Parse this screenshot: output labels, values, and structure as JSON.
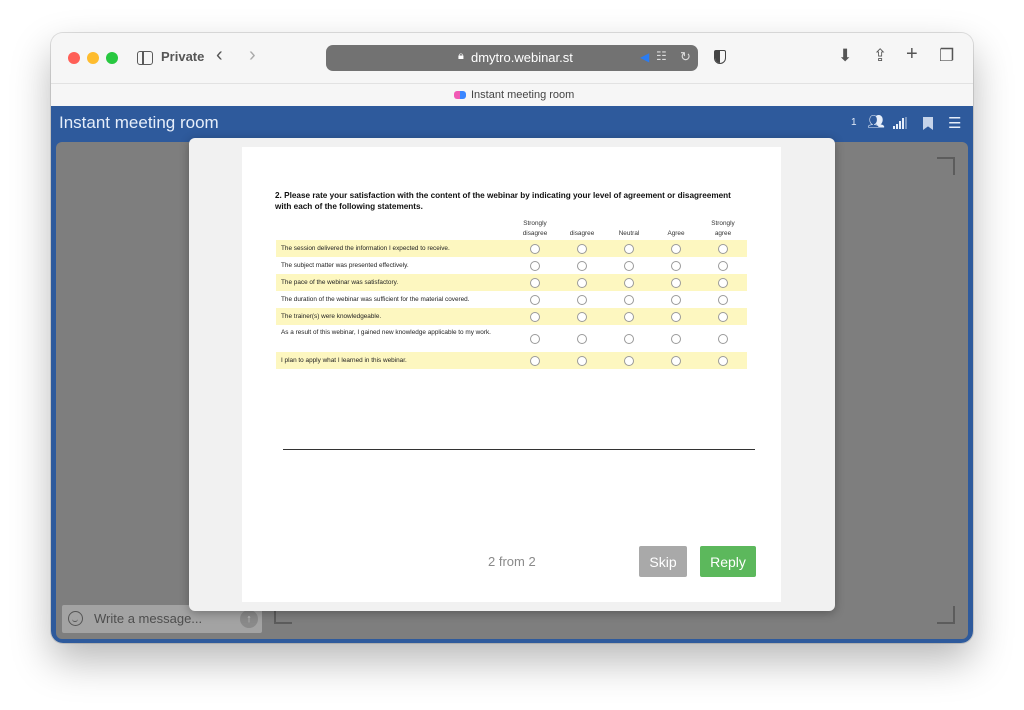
{
  "browser": {
    "mode_label": "Private",
    "url": "dmytro.webinar.st",
    "tab_title": "Instant meeting room"
  },
  "app": {
    "title": "Instant meeting room",
    "participant_count": "1"
  },
  "chat": {
    "placeholder": "Write a message..."
  },
  "survey": {
    "question": "2. Please rate your satisfaction with the content of the webinar by indicating your level of agreement or disagreement with each of the following statements.",
    "columns": [
      "Strongly\ndisagree",
      "disagree",
      "Neutral",
      "Agree",
      "Strongly\nagree"
    ],
    "rows": [
      "The session delivered the information I expected to receive.",
      "The subject matter was presented effectively.",
      "The pace of the webinar was satisfactory.",
      "The duration of the webinar was sufficient for the material covered.",
      "The trainer(s) were knowledgeable.",
      "As a result of this webinar, I gained new knowledge applicable to my work.",
      "I plan to apply what I learned in this webinar."
    ],
    "pager": "2 from 2",
    "skip_label": "Skip",
    "reply_label": "Reply"
  },
  "colors": {
    "header_blue": "#2e5a9c",
    "row_highlight": "#fdf7c0",
    "reply_green": "#5cb85c",
    "skip_grey": "#a9a9a9"
  }
}
